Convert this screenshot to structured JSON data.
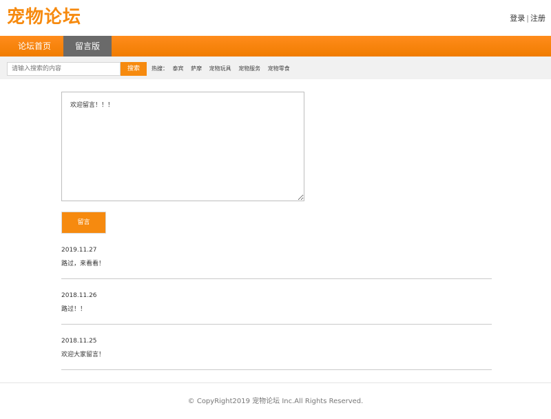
{
  "header": {
    "logo": "宠物论坛",
    "login": "登录",
    "separator": "|",
    "register": "注册"
  },
  "nav": {
    "items": [
      {
        "label": "论坛首页",
        "active": false
      },
      {
        "label": "留言版",
        "active": true
      }
    ],
    "active_color": "#6a6a6a",
    "bar_color": "#f68a0f"
  },
  "search": {
    "placeholder": "请输入搜索的内容",
    "button": "搜索",
    "hot_label": "热搜：",
    "hot_items": [
      "泰宾",
      "萨摩",
      "宠物玩具",
      "宠物服务",
      "宠物零食"
    ]
  },
  "message_form": {
    "value": "欢迎留言！！！",
    "submit": "留言"
  },
  "posts": [
    {
      "date": "2019.11.27",
      "text": "路过，来看看！"
    },
    {
      "date": "2018.11.26",
      "text": "路过！！"
    },
    {
      "date": "2018.11.25",
      "text": "欢迎大家留言！"
    }
  ],
  "footer": {
    "copyright": "© CopyRight2019 宠物论坛 Inc.All Rights Reserved."
  }
}
